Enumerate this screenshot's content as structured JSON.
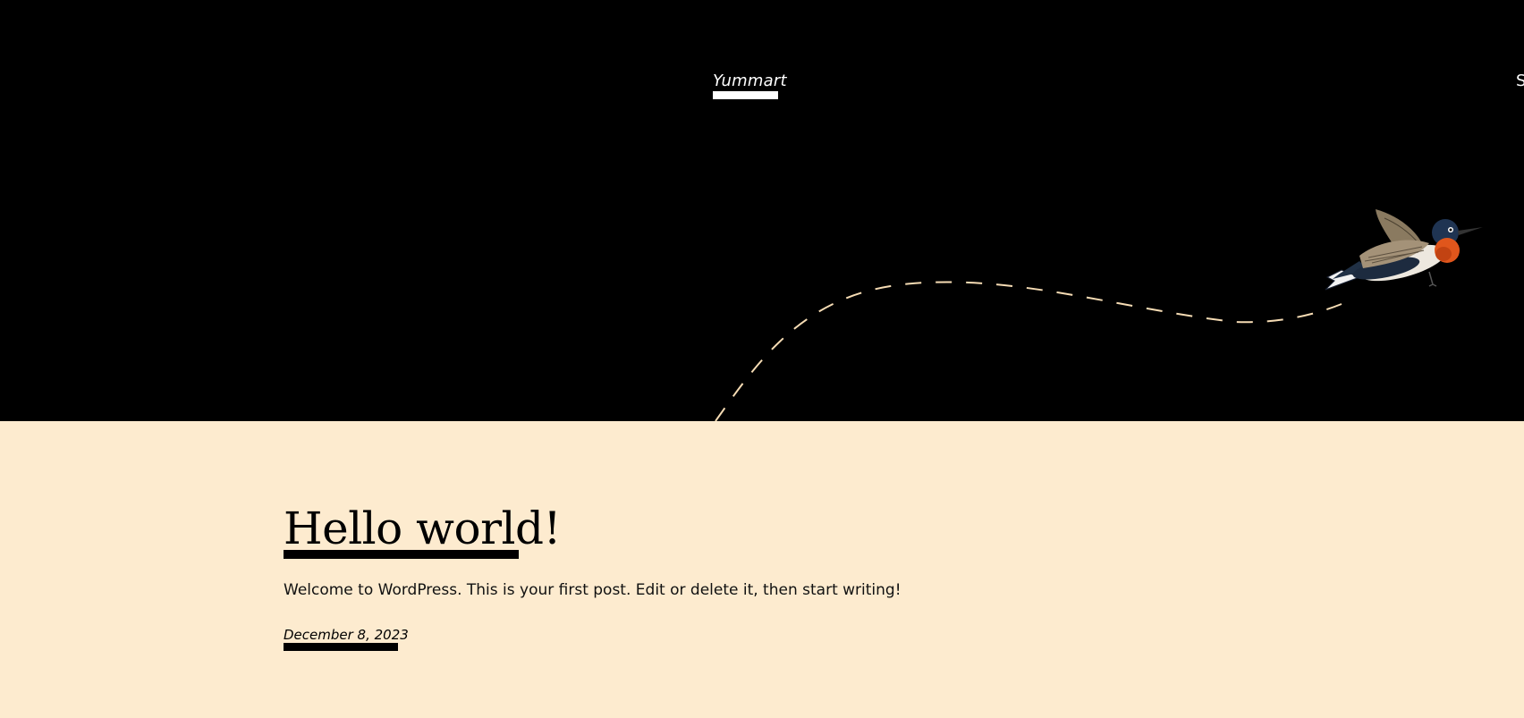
{
  "header": {
    "site_title": "Yummart",
    "nav_fragment": "S",
    "hero_illustration": "bird-flight-icon"
  },
  "post": {
    "title": "Hello world!",
    "excerpt": "Welcome to WordPress. This is your first post. Edit or delete it, then start writing!",
    "date": "December 8, 2023"
  },
  "colors": {
    "header_bg": "#000000",
    "content_bg": "#fdebcf",
    "dash_path": "#f6dcb4",
    "bird_throat": "#e0561c"
  }
}
